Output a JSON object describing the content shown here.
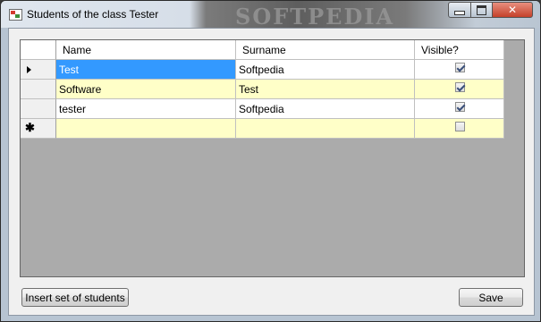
{
  "window": {
    "title": "Students of the class Tester",
    "watermark": "SOFTPEDIA"
  },
  "table": {
    "columns": [
      "Name",
      "Surname",
      "Visible?"
    ],
    "rows": [
      {
        "name": "Test",
        "surname": "Softpedia",
        "visible": true
      },
      {
        "name": "Software",
        "surname": "Test",
        "visible": true
      },
      {
        "name": "tester",
        "surname": "Softpedia",
        "visible": true
      },
      {
        "name": "",
        "surname": "",
        "visible": false
      }
    ],
    "new_row_symbol": "✱"
  },
  "buttons": {
    "insert_label": "Insert set of students",
    "save_label": "Save"
  },
  "colors": {
    "selection": "#3399ff",
    "alt_row": "#ffffc8",
    "grid_background": "#ababab"
  }
}
